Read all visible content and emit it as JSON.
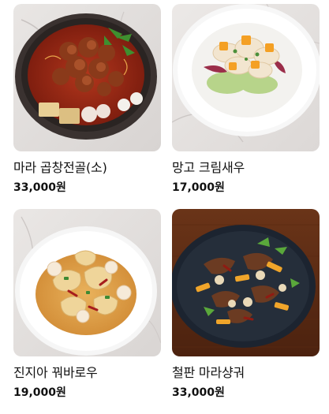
{
  "menu": {
    "items": [
      {
        "name": "마라 곱창전골(소)",
        "price": "33,000원",
        "image": "mala-gopchang-hotpot-photo"
      },
      {
        "name": "망고 크림새우",
        "price": "17,000원",
        "image": "mango-cream-shrimp-photo"
      },
      {
        "name": "진지아 꿔바로우",
        "price": "19,000원",
        "image": "jinjia-guobaorou-photo"
      },
      {
        "name": "철판 마라샹궈",
        "price": "33,000원",
        "image": "iron-plate-mala-xiangguo-photo"
      }
    ]
  }
}
